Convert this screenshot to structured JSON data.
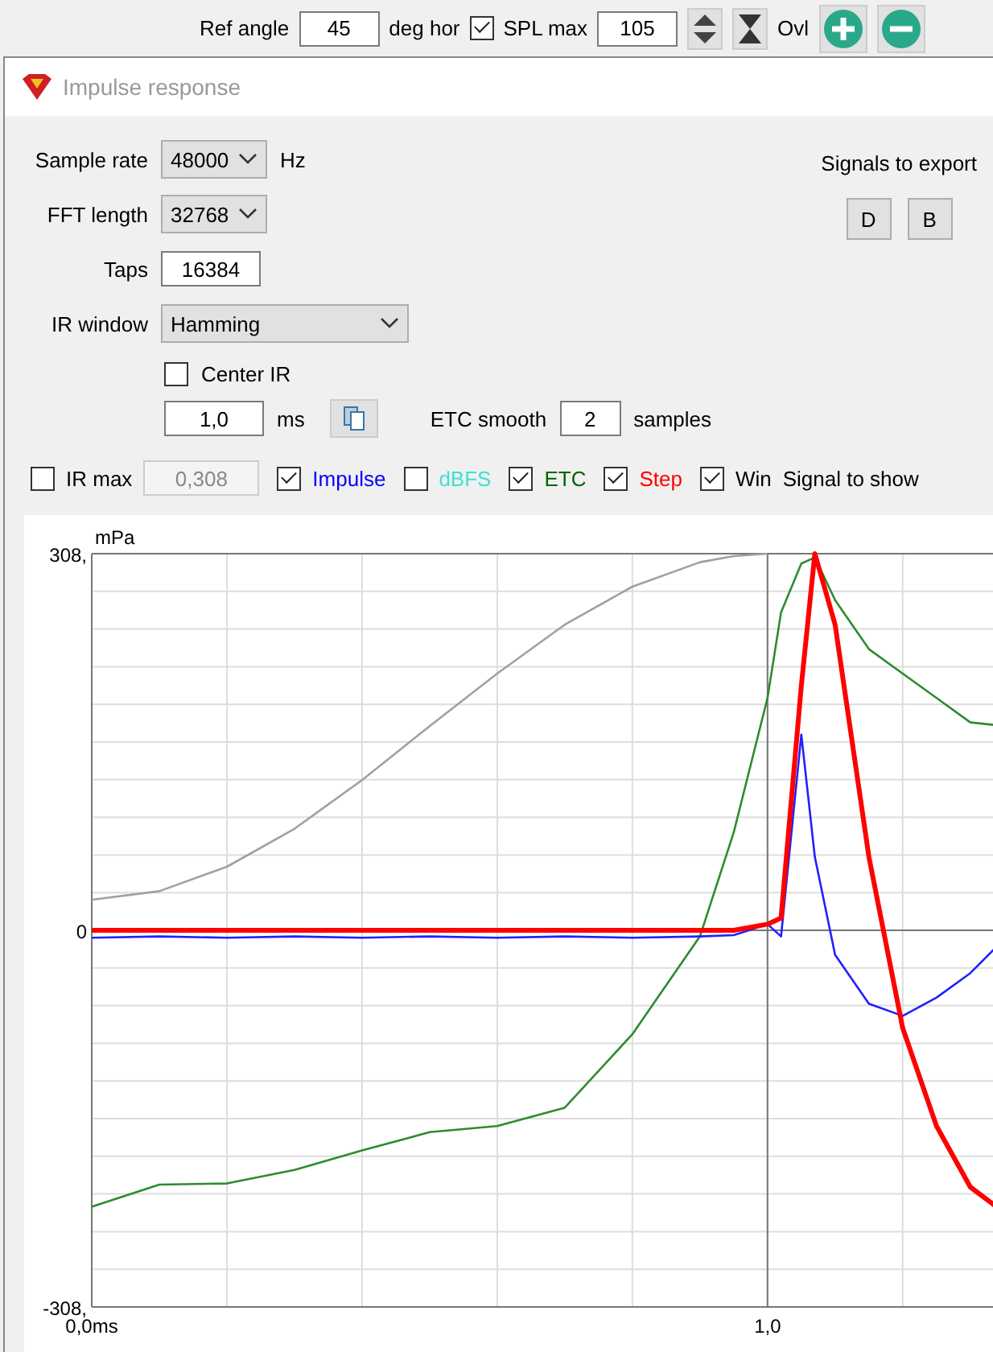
{
  "toolbar": {
    "ref_angle_label": "Ref angle",
    "ref_angle": "45",
    "ref_angle_unit": "deg hor",
    "spl_max": {
      "label": "SPL max",
      "checked": true
    },
    "spl_max_value": "105",
    "ovl_label": "Ovl"
  },
  "dialog": {
    "title": "Impulse response",
    "fields": [
      {
        "kind": "select",
        "label": "Sample rate",
        "value": "48000",
        "unit": "Hz"
      },
      {
        "kind": "select",
        "label": "FFT length",
        "value": "32768"
      },
      {
        "kind": "input",
        "label": "Taps",
        "value": "16384"
      },
      {
        "kind": "wide-select",
        "label": "IR window",
        "value": "Hamming"
      }
    ],
    "center_ir": {
      "label": "Center IR",
      "checked": false
    },
    "ms_value": "1,0",
    "ms_unit": "ms",
    "etc_smooth": {
      "label": "ETC smooth",
      "value": "2",
      "unit": "samples"
    },
    "export": {
      "label": "Signals to export",
      "buttons": [
        "D",
        "B"
      ]
    },
    "ir_max": {
      "label": "IR max",
      "checked": false,
      "disabled": true,
      "value": "0,308"
    },
    "signals": [
      {
        "label": "Impulse",
        "checked": true,
        "color": "#0000ff"
      },
      {
        "label": "dBFS",
        "checked": false,
        "color": "#40e0d0"
      },
      {
        "label": "ETC",
        "checked": true,
        "color": "#006400"
      },
      {
        "label": "Step",
        "checked": true,
        "color": "#ff0000"
      },
      {
        "label": "Win",
        "checked": true,
        "color": "#000000"
      }
    ],
    "signal_to_show": "Signal to show",
    "chart_data": {
      "type": "line",
      "ylabel": "mPa",
      "xlim": [
        0,
        1.336
      ],
      "ylim": [
        -308,
        308
      ],
      "x": [
        0,
        0.1,
        0.2,
        0.3,
        0.4,
        0.5,
        0.6,
        0.7,
        0.8,
        0.9,
        0.95,
        1.0,
        1.02,
        1.05,
        1.07,
        1.1,
        1.15,
        1.2,
        1.25,
        1.3,
        1.336
      ],
      "yticks": [
        {
          "value": -308,
          "label": "-308,"
        },
        {
          "value": 0,
          "label": "0"
        },
        {
          "value": 308,
          "label": "308,"
        }
      ],
      "xticks": [
        {
          "value": 0,
          "label": "0,0ms"
        },
        {
          "value": 1.0,
          "label": "1,0"
        }
      ],
      "series": [
        {
          "color": "#a0a0a0",
          "values": [
            25,
            32,
            52,
            83,
            123,
            167,
            210,
            250,
            281,
            301,
            306,
            308,
            null,
            null,
            null,
            null,
            null,
            null,
            null,
            null,
            null
          ]
        },
        {
          "color": "#2e8b2e",
          "values": [
            -226,
            -208,
            -207,
            -196,
            -180,
            -165,
            -160,
            -145,
            -85,
            -5,
            80,
            190,
            260,
            300,
            305,
            270,
            230,
            210,
            190,
            170,
            168
          ]
        },
        {
          "color": "#2020ff",
          "values": [
            -6,
            -5,
            -6,
            -5,
            -6,
            -5,
            -6,
            -5,
            -6,
            -5,
            -4,
            5,
            -5,
            160,
            60,
            -20,
            -60,
            -70,
            -55,
            -35,
            -15
          ]
        },
        {
          "color": "#ff0000",
          "values": [
            0,
            0,
            0,
            0,
            0,
            0,
            0,
            0,
            0,
            0,
            0,
            5,
            10,
            200,
            308,
            250,
            60,
            -80,
            -160,
            -210,
            -225
          ]
        }
      ]
    }
  }
}
